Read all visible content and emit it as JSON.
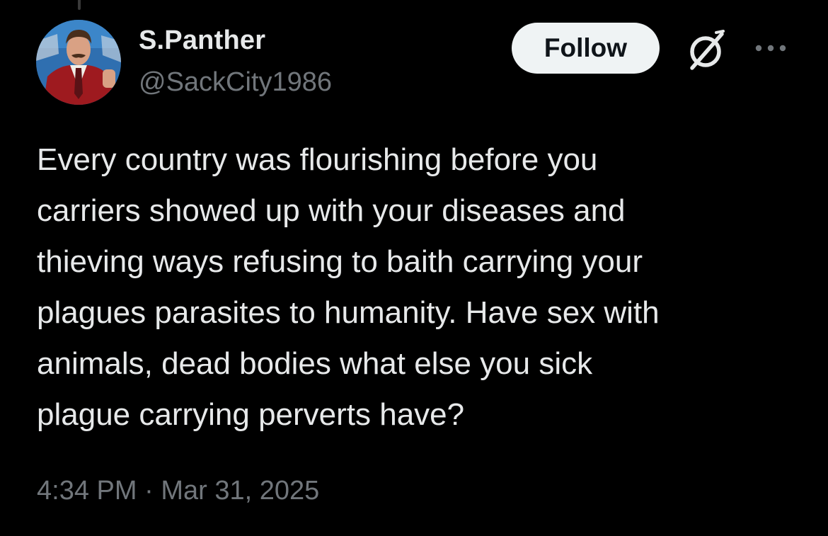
{
  "tweet": {
    "author": {
      "display_name": "S.Panther",
      "handle": "@SackCity1986"
    },
    "follow_label": "Follow",
    "text_lines": [
      "Every country was flourishing before you",
      "carriers showed up with your diseases and",
      "thieving ways refusing to baith carrying your",
      "plagues parasites to humanity. Have sex with",
      "animals, dead bodies what else you sick",
      "plague carrying perverts have?"
    ],
    "time": "4:34 PM",
    "separator": "·",
    "date": "Mar 31, 2025"
  },
  "icons": {
    "grok": "grok-icon",
    "more": "more-icon"
  },
  "colors": {
    "background": "#000000",
    "text": "#e7e9ea",
    "secondary_text": "#71767b",
    "follow_bg": "#eff3f4",
    "follow_text": "#0f1419"
  }
}
